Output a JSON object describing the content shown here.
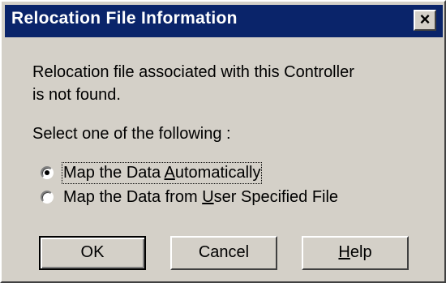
{
  "window": {
    "title": "Relocation File Information",
    "close_glyph": "×"
  },
  "message": {
    "line1": "Relocation file associated with this Controller",
    "line2": "is not found."
  },
  "prompt": "Select one of the following :",
  "options": [
    {
      "pre": "Map the Data ",
      "accel": "A",
      "post": "utomatically",
      "selected": true
    },
    {
      "pre": "Map the Data from ",
      "accel": "U",
      "post": "ser Specified File",
      "selected": false
    }
  ],
  "buttons": {
    "ok": {
      "label": "OK"
    },
    "cancel": {
      "label": "Cancel"
    },
    "help": {
      "accel": "H",
      "rest": "elp"
    }
  },
  "colors": {
    "titlebar": "#0a246a",
    "face": "#d4d0c8"
  }
}
